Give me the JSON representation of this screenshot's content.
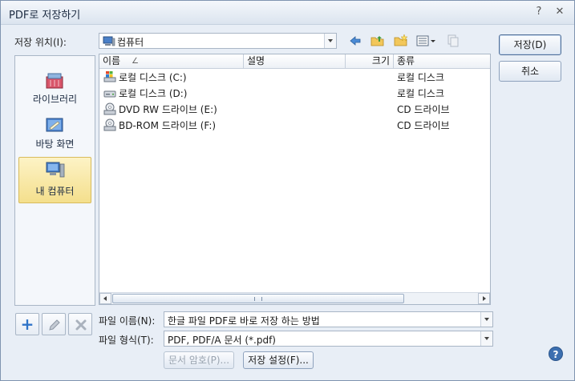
{
  "window": {
    "title": "PDF로 저장하기",
    "help_glyph": "?",
    "close_glyph": "✕"
  },
  "location": {
    "label": "저장 위치(I):",
    "value": "컴퓨터"
  },
  "buttons": {
    "save": "저장(D)",
    "cancel": "취소",
    "doc_password": "문서 암호(P)...",
    "save_settings": "저장 설정(F)..."
  },
  "places": [
    {
      "label": "라이브러리",
      "icon": "library-icon"
    },
    {
      "label": "바탕 화면",
      "icon": "desktop-icon"
    },
    {
      "label": "내 컴퓨터",
      "icon": "computer-icon",
      "selected": true
    }
  ],
  "columns": {
    "name": "이름",
    "sort_glyph": "∠",
    "description": "설명",
    "size": "크기",
    "type": "종류"
  },
  "rows": [
    {
      "name": "로컬 디스크 (C:)",
      "type": "로컬 디스크",
      "icon": "windows-drive-icon"
    },
    {
      "name": "로컬 디스크 (D:)",
      "type": "로컬 디스크",
      "icon": "hard-drive-icon"
    },
    {
      "name": "DVD RW 드라이브 (E:)",
      "type": "CD 드라이브",
      "icon": "dvd-drive-icon"
    },
    {
      "name": "BD-ROM 드라이브 (F:)",
      "type": "CD 드라이브",
      "icon": "bd-drive-icon"
    }
  ],
  "filename": {
    "label": "파일 이름(N):",
    "value": "한글 파일 PDF로 바로 저장 하는 방법"
  },
  "filetype": {
    "label": "파일 형식(T):",
    "value": "PDF, PDF/A 문서 (*.pdf)"
  },
  "colors": {
    "accent": "#3c6fb0",
    "selection": "#f4df8c"
  }
}
